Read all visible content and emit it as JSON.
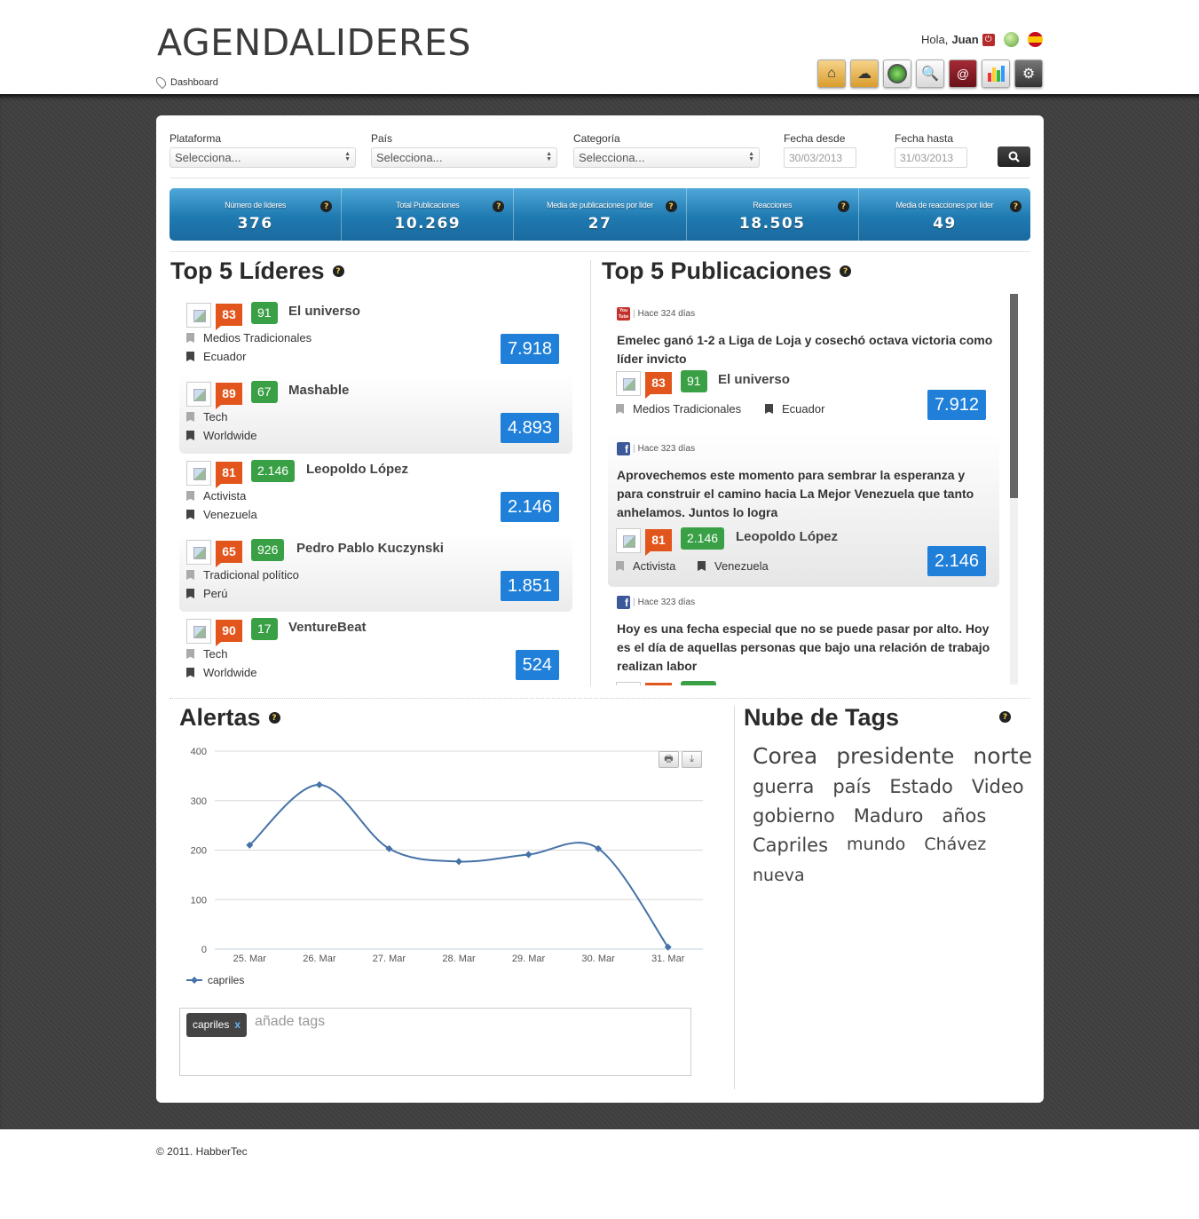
{
  "header": {
    "logo": "AGENDALIDERES",
    "breadcrumb": "Dashboard",
    "greeting_prefix": "Hola,",
    "user": "Juan",
    "toolbar_icons": [
      "home-folder-icon",
      "cloud-folder-icon",
      "radar-icon",
      "search-icon",
      "contacts-icon",
      "chart-icon",
      "settings-icon"
    ]
  },
  "filters": {
    "platform_label": "Plataforma",
    "platform_value": "Selecciona...",
    "country_label": "País",
    "country_value": "Selecciona...",
    "category_label": "Categoría",
    "category_value": "Selecciona...",
    "date_from_label": "Fecha desde",
    "date_from_value": "30/03/2013",
    "date_to_label": "Fecha hasta",
    "date_to_value": "31/03/2013"
  },
  "stats": [
    {
      "label": "Número de líderes",
      "value": "376"
    },
    {
      "label": "Total Publicaciones",
      "value": "10.269"
    },
    {
      "label": "Media de publicaciones por líder",
      "value": "27"
    },
    {
      "label": "Reacciones",
      "value": "18.505"
    },
    {
      "label": "Media de reacciones por líder",
      "value": "49"
    }
  ],
  "top_leaders": {
    "title": "Top 5 Líderes",
    "items": [
      {
        "score_a": "83",
        "score_b": "91",
        "name": "El universo",
        "category": "Medios Tradicionales",
        "country": "Ecuador",
        "total": "7.918"
      },
      {
        "score_a": "89",
        "score_b": "67",
        "name": "Mashable",
        "category": "Tech",
        "country": "Worldwide",
        "total": "4.893"
      },
      {
        "score_a": "81",
        "score_b": "2.146",
        "name": "Leopoldo López",
        "category": "Activista",
        "country": "Venezuela",
        "total": "2.146"
      },
      {
        "score_a": "65",
        "score_b": "926",
        "name": "Pedro Pablo Kuczynski",
        "category": "Tradicional político",
        "country": "Perú",
        "total": "1.851"
      },
      {
        "score_a": "90",
        "score_b": "17",
        "name": "VentureBeat",
        "category": "Tech",
        "country": "Worldwide",
        "total": "524"
      }
    ]
  },
  "top_publications": {
    "title": "Top 5 Publicaciones",
    "items": [
      {
        "source": "youtube",
        "date": "Hace 324 días",
        "text": "Emelec ganó 1-2 a Liga de Loja y cosechó octava victoria como líder invicto",
        "score_a": "83",
        "score_b": "91",
        "author": "El universo",
        "category": "Medios Tradicionales",
        "country": "Ecuador",
        "total": "7.912"
      },
      {
        "source": "facebook",
        "date": "Hace 323 días",
        "text": "Aprovechemos este momento para sembrar la esperanza y para construir el camino hacia La Mejor Venezuela que tanto anhelamos. Juntos lo logra",
        "score_a": "81",
        "score_b": "2.146",
        "author": "Leopoldo López",
        "category": "Activista",
        "country": "Venezuela",
        "total": "2.146"
      },
      {
        "source": "facebook",
        "date": "Hace 323 días",
        "text": "Hoy es una fecha especial que no se puede pasar por alto. Hoy es el día de aquellas personas que bajo una relación de trabajo realizan labor"
      }
    ]
  },
  "alerts": {
    "title": "Alertas",
    "legend": "capriles"
  },
  "chart_data": {
    "type": "line",
    "categories": [
      "25. Mar",
      "26. Mar",
      "27. Mar",
      "28. Mar",
      "29. Mar",
      "30. Mar",
      "31. Mar"
    ],
    "series": [
      {
        "name": "capriles",
        "values": [
          210,
          332,
          203,
          177,
          191,
          203,
          4
        ]
      }
    ],
    "yticks": [
      "0",
      "100",
      "200",
      "300",
      "400"
    ],
    "ylim": [
      0,
      400
    ],
    "color": "#4572a7",
    "grid": true,
    "legend_position": "bottom-left"
  },
  "tags_input": {
    "chip": "capriles",
    "remove": "x",
    "placeholder": "añade tags"
  },
  "tag_cloud": {
    "title": "Nube de Tags",
    "rows": [
      [
        "Corea",
        "presidente",
        "norte"
      ],
      [
        "guerra",
        "país",
        "Estado",
        "Video"
      ],
      [
        "gobierno",
        "Maduro",
        "años"
      ],
      [
        "Capriles",
        "mundo",
        "Chávez"
      ],
      [
        "nueva"
      ]
    ]
  },
  "footer": "© 2011. HabberTec"
}
